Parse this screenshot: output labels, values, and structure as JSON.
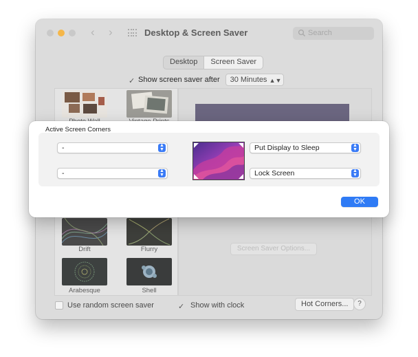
{
  "window": {
    "title": "Desktop & Screen Saver",
    "search_placeholder": "Search"
  },
  "tabs": [
    "Desktop",
    "Screen Saver"
  ],
  "show_after": {
    "label": "Show screen saver after",
    "value": "30 Minutes"
  },
  "screen_savers": [
    {
      "label": "Photo Wall"
    },
    {
      "label": "Vintage Prints"
    },
    {
      "label": "Drift"
    },
    {
      "label": "Flurry"
    },
    {
      "label": "Arabesque"
    },
    {
      "label": "Shell"
    }
  ],
  "options_button": "Screen Saver Options...",
  "bottom": {
    "random_label": "Use random screen saver",
    "clock_label": "Show with clock",
    "hot_corners_button": "Hot Corners...",
    "help_button": "?"
  },
  "sheet": {
    "title": "Active Screen Corners",
    "top_left": "-",
    "bottom_left": "-",
    "top_right": "Put Display to Sleep",
    "bottom_right": "Lock Screen",
    "ok_button": "OK"
  },
  "colors": {
    "accent": "#2f7bf5",
    "minimize": "#f5b74a"
  }
}
